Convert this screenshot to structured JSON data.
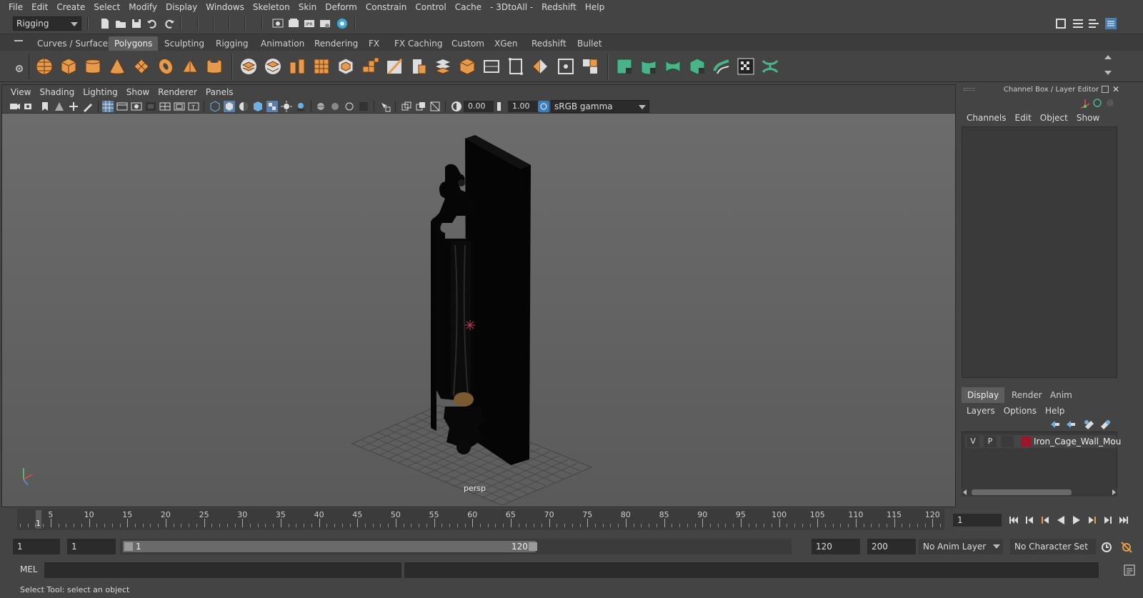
{
  "menubar": {
    "items": [
      "File",
      "Edit",
      "Create",
      "Select",
      "Modify",
      "Display",
      "Windows",
      "Skeleton",
      "Skin",
      "Deform",
      "Constrain",
      "Control",
      "Cache",
      "- 3DtoAll -",
      "Redshift",
      "Help"
    ]
  },
  "statusline": {
    "menuset": "Rigging"
  },
  "shelf": {
    "tabs": [
      "Curves / Surfaces",
      "Polygons",
      "Sculpting",
      "Rigging",
      "Animation",
      "Rendering",
      "FX",
      "FX Caching",
      "Custom",
      "XGen",
      "Redshift",
      "Bullet"
    ],
    "active_tab": "Polygons"
  },
  "viewport": {
    "menu": [
      "View",
      "Shading",
      "Lighting",
      "Show",
      "Renderer",
      "Panels"
    ],
    "exposure": "0.00",
    "gamma": "1.00",
    "color_space": "sRGB gamma",
    "camera_label": "persp"
  },
  "right_panel": {
    "title": "Channel Box / Layer Editor",
    "channel_menu": [
      "Channels",
      "Edit",
      "Object",
      "Show"
    ],
    "layer_tabs": [
      "Display",
      "Render",
      "Anim"
    ],
    "active_layer_tab": "Display",
    "layer_menu": [
      "Layers",
      "Options",
      "Help"
    ],
    "layers": [
      {
        "v": "V",
        "p": "P",
        "name": "Iron_Cage_Wall_Mount_",
        "color": "#a0152e"
      }
    ]
  },
  "timeline": {
    "labels": [
      "5",
      "10",
      "15",
      "20",
      "25",
      "30",
      "35",
      "40",
      "45",
      "50",
      "55",
      "60",
      "65",
      "70",
      "75",
      "80",
      "85",
      "90",
      "95",
      "100",
      "105",
      "110",
      "115",
      "120"
    ],
    "current_frame_label": "1",
    "current_frame": "1"
  },
  "range": {
    "start": "1",
    "playback_start": "1",
    "slider_start": "1",
    "slider_end": "120",
    "playback_end": "120",
    "end": "200",
    "anim_layer": "No Anim Layer",
    "character_set": "No Character Set"
  },
  "cmdline": {
    "label": "MEL"
  },
  "helpline": {
    "text": "Select Tool: select an object"
  }
}
